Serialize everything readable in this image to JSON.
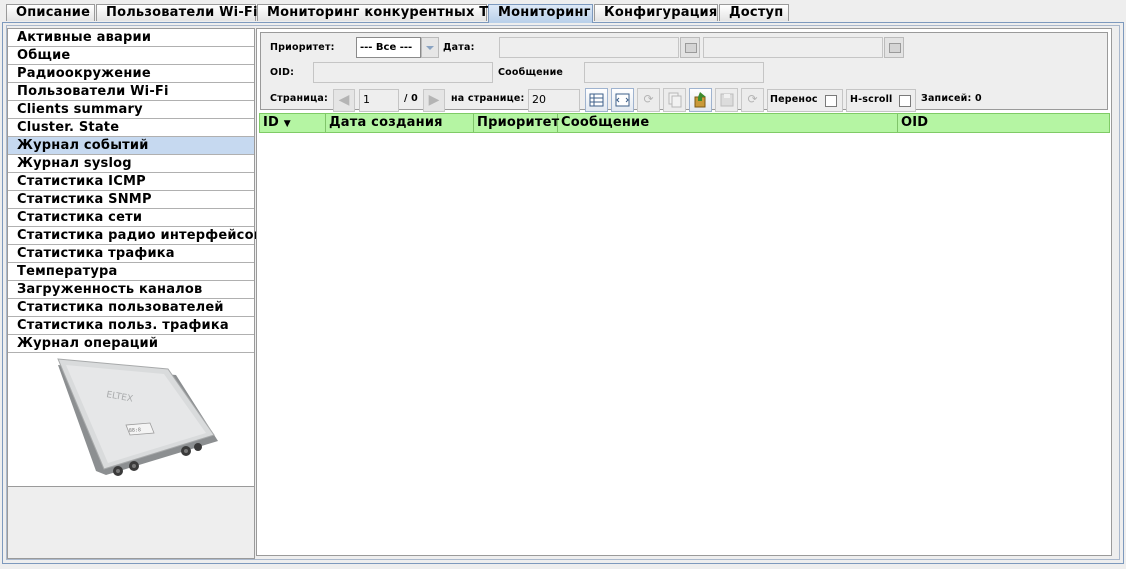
{
  "tabs": [
    {
      "label": "Описание",
      "active": false
    },
    {
      "label": "Пользователи Wi-Fi",
      "active": false
    },
    {
      "label": "Мониторинг конкурентных ТД",
      "active": false
    },
    {
      "label": "Мониторинг",
      "active": true
    },
    {
      "label": "Конфигурация",
      "active": false
    },
    {
      "label": "Доступ",
      "active": false
    }
  ],
  "sidebar": {
    "items": [
      {
        "label": "Активные аварии"
      },
      {
        "label": "Общие"
      },
      {
        "label": "Радиоокружение"
      },
      {
        "label": "Пользователи Wi-Fi"
      },
      {
        "label": "Clients summary"
      },
      {
        "label": "Cluster. State"
      },
      {
        "label": "Журнал событий",
        "selected": true
      },
      {
        "label": "Журнал syslog"
      },
      {
        "label": "Статистика ICMP"
      },
      {
        "label": "Статистика SNMP"
      },
      {
        "label": "Статистика сети"
      },
      {
        "label": "Статистика радио интерфейсов"
      },
      {
        "label": "Статистика трафика"
      },
      {
        "label": "Температура"
      },
      {
        "label": "Загруженность каналов"
      },
      {
        "label": "Статистика пользователей"
      },
      {
        "label": "Статистика польз. трафика"
      },
      {
        "label": "Журнал операций"
      }
    ],
    "device_logo_text": "ELTEX"
  },
  "filters": {
    "priority_label": "Приоритет:",
    "priority_value": "--- Все ---",
    "date_label": "Дата:",
    "date_from": "",
    "date_to": "",
    "oid_label": "OID:",
    "oid_value": "",
    "message_label": "Сообщение",
    "message_value": ""
  },
  "pager": {
    "page_label": "Страница:",
    "page_value": "1",
    "page_total": "/ 0",
    "per_page_label": "на странице:",
    "per_page_value": "20",
    "wrap_label": "Перенос",
    "hscroll_label": "H-scroll",
    "records_label": "Записей: 0"
  },
  "toolbar_icons": [
    "columns-icon",
    "fit-icon",
    "refresh-icon",
    "copy-icon",
    "export-icon",
    "save-icon",
    "auto-refresh-icon"
  ],
  "colors": {
    "header_bg": "#b5f5a3",
    "selected_item": "#c6d9f0",
    "active_tab": "#b8cfe9"
  },
  "table": {
    "columns": [
      {
        "label": "ID",
        "sort_indicator": "▼"
      },
      {
        "label": "Дата создания"
      },
      {
        "label": "Приоритет"
      },
      {
        "label": "Сообщение"
      },
      {
        "label": "OID"
      }
    ],
    "rows": []
  }
}
